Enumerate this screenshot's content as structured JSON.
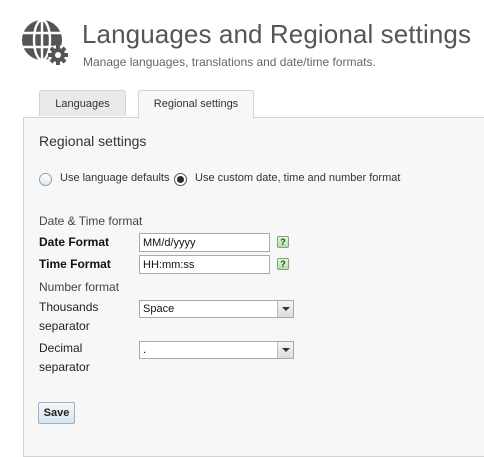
{
  "header": {
    "title": "Languages and Regional settings",
    "subtitle": "Manage languages, translations and date/time formats.",
    "icon": "globe-gear-icon"
  },
  "tabs": [
    {
      "label": "Languages",
      "active": false
    },
    {
      "label": "Regional settings",
      "active": true
    }
  ],
  "regional": {
    "title": "Regional settings",
    "format_options": [
      {
        "label": "Use language defaults",
        "checked": false
      },
      {
        "label": "Use custom date, time and number format",
        "checked": true
      }
    ],
    "date_time_heading": "Date & Time format",
    "date_format": {
      "label": "Date Format",
      "value": "MM/d/yyyy",
      "help": "?"
    },
    "time_format": {
      "label": "Time Format",
      "value": "HH:mm:ss",
      "help": "?"
    },
    "number_heading": "Number format",
    "thousands_separator": {
      "label_line1": "Thousands",
      "label_line2": "separator",
      "value": "Space"
    },
    "decimal_separator": {
      "label_line1": "Decimal",
      "label_line2": "separator",
      "value": "."
    },
    "save_label": "Save"
  },
  "colors": {
    "panel_background": "#f7f7f7",
    "border": "#d2d2d2",
    "help_icon": "#b8dca8",
    "button": "#d6e3ef"
  }
}
